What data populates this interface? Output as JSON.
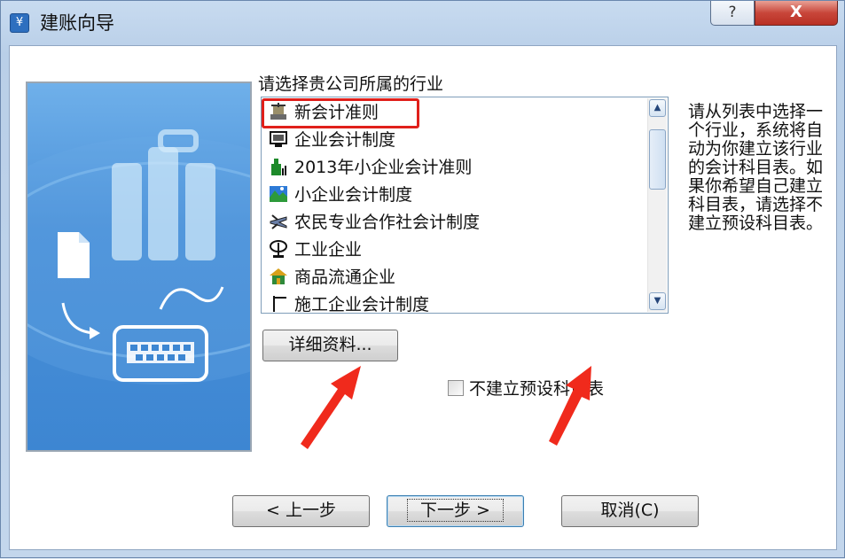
{
  "window": {
    "title": "建账向导",
    "help_glyph": "?",
    "close_glyph": "X"
  },
  "industry_label": "请选择贵公司所属的行业",
  "industries": [
    {
      "label": "新会计准则",
      "icon": "scale-building-icon",
      "selected": true
    },
    {
      "label": "企业会计制度",
      "icon": "monitor-icon"
    },
    {
      "label": "2013年小企业会计准则",
      "icon": "bottle-chart-icon"
    },
    {
      "label": "小企业会计制度",
      "icon": "landscape-icon"
    },
    {
      "label": "农民专业合作社会计制度",
      "icon": "airplane-icon"
    },
    {
      "label": "工业企业",
      "icon": "lamp-icon"
    },
    {
      "label": "商品流通企业",
      "icon": "house-icon"
    },
    {
      "label": "施工企业会计制度",
      "icon": "crane-icon"
    }
  ],
  "hint_text": "请从列表中选择一个行业，系统将自动为你建立该行业的会计科目表。如果你希望自己建立科目表，请选择不建立预设科目表。",
  "details_button": "详细资料...",
  "no_preset_checkbox": {
    "label": "不建立预设科目表",
    "checked": false
  },
  "nav": {
    "back": "< 上一步",
    "next": "下一步 >",
    "cancel": "取消(C)"
  },
  "colors": {
    "highlight_frame": "#e0201b",
    "annotation_arrow": "#f02a1c",
    "title_bar": "#c3d6ec"
  }
}
